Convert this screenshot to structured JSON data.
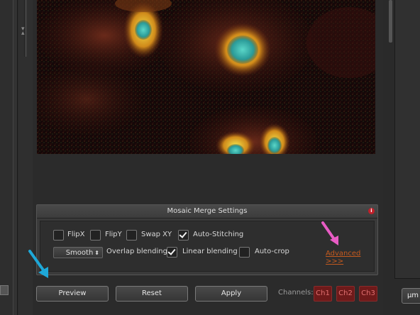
{
  "settings_panel": {
    "title": "Mosaic Merge Settings",
    "flipx": {
      "label": "FlipX",
      "checked": false
    },
    "flipy": {
      "label": "FlipY",
      "checked": false
    },
    "swapxy": {
      "label": "Swap XY",
      "checked": false
    },
    "autostitching": {
      "label": "Auto-Stitching",
      "checked": true
    },
    "blending_mode": {
      "value": "Smooth"
    },
    "overlap_blending": {
      "label": "Overlap blending"
    },
    "linear_blending": {
      "label": "Linear blending",
      "checked": true
    },
    "autocrop": {
      "label": "Auto-crop",
      "checked": false
    },
    "advanced_link": "Advanced >>>"
  },
  "buttons": {
    "preview": "Preview",
    "reset": "Reset",
    "apply": "Apply"
  },
  "channels": {
    "label": "Channels:",
    "items": [
      "Ch1",
      "Ch2",
      "Ch3"
    ]
  },
  "units": {
    "value": "µm"
  },
  "colors": {
    "background": "#2b2b2b",
    "advanced_link": "#c45a1e",
    "channel_button": "#6e1a1a",
    "annotation_pink": "#e85cc4",
    "annotation_blue": "#1ea8d8"
  }
}
